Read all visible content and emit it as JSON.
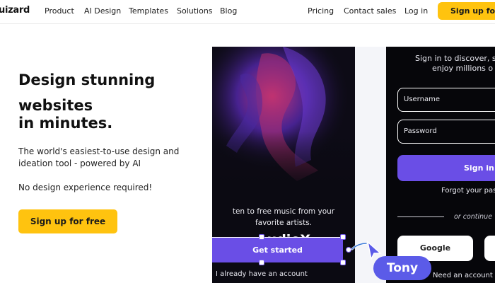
{
  "nav": {
    "logo": "uizard",
    "links": [
      "Product",
      "AI Design",
      "Templates",
      "Solutions",
      "Blog"
    ],
    "right_links": [
      "Pricing",
      "Contact sales",
      "Log in"
    ],
    "cta": "Sign up for free"
  },
  "hero": {
    "title_lines": [
      "Design stunning",
      "websites",
      "in minutes."
    ],
    "subtitle_lines": [
      "The world's easiest-to-use design and",
      "ideation tool - powered by AI"
    ],
    "note": "No design experience required!",
    "cta": "Sign up for free"
  },
  "mock_audio": {
    "title": "AudioX",
    "subtitle_lines": [
      "ten to free music from your",
      "favorite artists."
    ],
    "button": "Get started",
    "account_text": "I already have an account"
  },
  "mock_signin": {
    "heading_lines": [
      "Sign in to discover, s",
      "enjoy millions o"
    ],
    "username_placeholder": "Username",
    "password_placeholder": "Password",
    "button": "Sign in",
    "forgot": "Forgot your pas",
    "or_continue": "or continue w",
    "google": "Google",
    "footer": "Need an account"
  },
  "cursor_tag": "Tony",
  "colors": {
    "accent_yellow": "#ffc30f",
    "accent_purple": "#6a4ee6",
    "cursor_blue": "#5b5be8"
  }
}
